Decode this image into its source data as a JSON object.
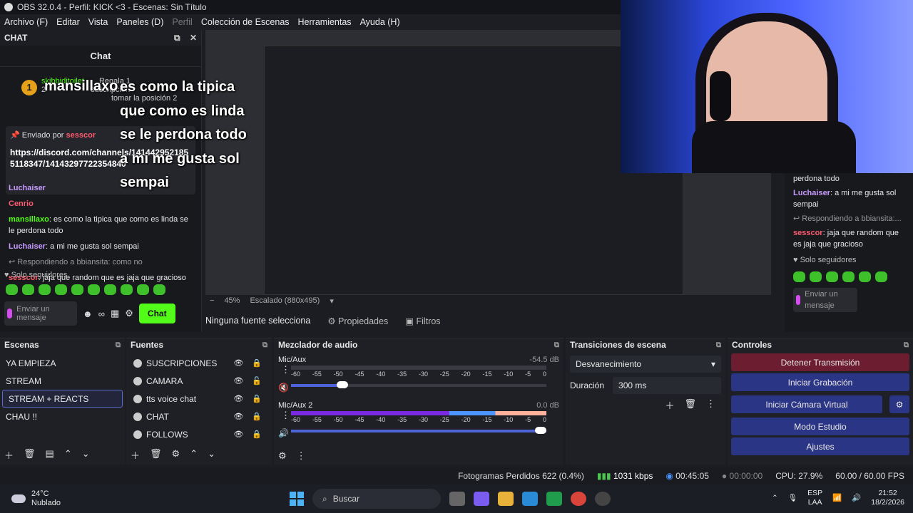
{
  "window": {
    "title": "OBS 32.0.4 - Perfil: KICK <3 - Escenas: Sin Título"
  },
  "menu": [
    {
      "label": "Archivo (F)",
      "enabled": true
    },
    {
      "label": "Editar",
      "enabled": true
    },
    {
      "label": "Vista",
      "enabled": true
    },
    {
      "label": "Paneles (D)",
      "enabled": true
    },
    {
      "label": "Perfil",
      "enabled": false
    },
    {
      "label": "Colección de Escenas",
      "enabled": true
    },
    {
      "label": "Herramientas",
      "enabled": true
    },
    {
      "label": "Ayuda (H)",
      "enabled": true
    }
  ],
  "chat": {
    "dock_title": "CHAT",
    "title": "Chat",
    "gift": {
      "user": "skibbiditoilet",
      "action": "Regala 1",
      "sub_line": "suscripción",
      "position": "tomar la posición 2",
      "count": "2"
    },
    "overlay": {
      "badge": "1",
      "user": "mansillaxo",
      "lines": [
        "es como la tipica",
        "que como es linda",
        "se le perdona todo",
        "a mi me gusta sol",
        "sempai"
      ]
    },
    "pinned": {
      "sent_by": "Enviado por",
      "sender": "sesscor",
      "link": "https://discord.com/channels/1414429521855118347/14143297722354840"
    },
    "messages": [
      {
        "user": "Luchaiser",
        "text": "",
        "user_color": "purple"
      },
      {
        "user": "Cenrio",
        "text": "",
        "user_color": "red"
      },
      {
        "user": "mansillaxo",
        "text": "es como la tipica que como es linda se le perdona todo",
        "user_color": "green"
      },
      {
        "user": "Luchaiser",
        "text": "a mi me gusta sol sempai",
        "user_color": "purple"
      },
      {
        "reply": "Respondiendo a bbiansita: como no"
      },
      {
        "user": "sesscor",
        "text": "jaja que random que es jaja que gracioso",
        "user_color": "red"
      }
    ],
    "followers_only": "Solo seguidores",
    "input_placeholder": "Enviar un mensaje",
    "send_label": "Chat"
  },
  "right_chat": {
    "messages": [
      {
        "user": "",
        "text": "perdona todo",
        "user_color": "green"
      },
      {
        "user": "Luchaiser",
        "text": "a mi me gusta sol sempai",
        "user_color": "purple"
      },
      {
        "reply": "Respondiendo a bbiansita:..."
      },
      {
        "user": "sesscor",
        "text": "jaja que random que es jaja que gracioso",
        "user_color": "red"
      }
    ],
    "followers_only": "Solo seguidores",
    "input_placeholder": "Enviar un mensaje"
  },
  "preview": {
    "zoom": "45%",
    "scaled": "Escalado (880x495)"
  },
  "source_toolbar": {
    "no_source": "Ninguna fuente selecciona",
    "properties": "Propiedades",
    "filters": "Filtros"
  },
  "scenes": {
    "title": "Escenas",
    "items": [
      "YA EMPIEZA",
      "STREAM",
      "STREAM + REACTS",
      "CHAU !!"
    ],
    "selected_index": 2
  },
  "sources": {
    "title": "Fuentes",
    "items": [
      "SUSCRIPCIONES",
      "CAMARA",
      "tts voice chat",
      "CHAT",
      "FOLLOWS"
    ]
  },
  "mixer": {
    "title": "Mezclador de audio",
    "ticks": [
      "-60",
      "-55",
      "-50",
      "-45",
      "-40",
      "-35",
      "-30",
      "-25",
      "-20",
      "-15",
      "-10",
      "-5",
      "0"
    ],
    "channels": [
      {
        "name": "Mic/Aux",
        "db": "-54.5 dB",
        "muted": true,
        "fader_percent": 20
      },
      {
        "name": "Mic/Aux 2",
        "db": "0.0 dB",
        "muted": false,
        "fader_percent": 100
      }
    ]
  },
  "transitions": {
    "title": "Transiciones de escena",
    "selected": "Desvanecimiento",
    "duration_label": "Duración",
    "duration_value": "300 ms"
  },
  "controls": {
    "title": "Controles",
    "stop_stream": "Detener Transmisión",
    "start_recording": "Iniciar Grabación",
    "start_virtual_cam": "Iniciar Cámara Virtual",
    "studio_mode": "Modo Estudio",
    "settings": "Ajustes"
  },
  "status": {
    "dropped_frames": "Fotogramas Perdidos 622 (0.4%)",
    "bitrate": "1031 kbps",
    "stream_time": "00:45:05",
    "rec_time": "00:00:00",
    "cpu": "CPU: 27.9%",
    "fps": "60.00 / 60.00 FPS"
  },
  "taskbar": {
    "temp": "24°C",
    "weather": "Nublado",
    "search": "Buscar",
    "lang": "ESP",
    "region": "LAA",
    "time": "21:52",
    "date": "18/2/2026"
  },
  "colors": {
    "kick_green": "#53fc18",
    "stop_red": "#6d1d30",
    "control_blue": "#2b3585"
  }
}
